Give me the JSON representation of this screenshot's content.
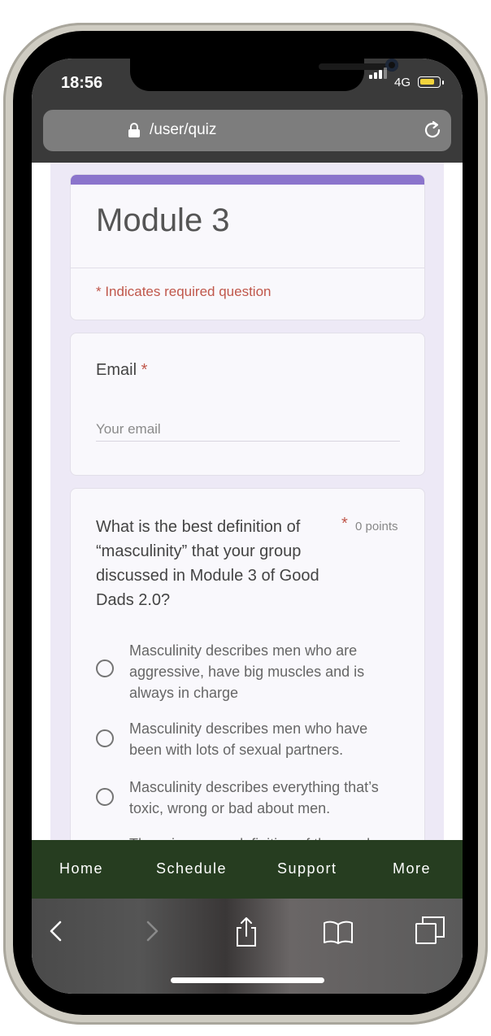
{
  "status_bar": {
    "time": "18:56",
    "network": "4G"
  },
  "browser": {
    "url": "/user/quiz"
  },
  "form": {
    "title": "Module 3",
    "required_note": "* Indicates required question",
    "email": {
      "label": "Email",
      "required_mark": "*",
      "placeholder": "Your email",
      "value": ""
    },
    "question": {
      "text": "What is the best definition of “masculinity” that your group discussed in Module 3 of Good Dads 2.0?",
      "required_mark": "*",
      "points": "0 points",
      "options": [
        "Masculinity describes men who are aggressive, have big muscles and is always in charge",
        "Masculinity describes men who have been with lots of sexual partners.",
        "Masculinity describes everything that’s toxic, wrong or bad about men.",
        "There is no one definition of the word..."
      ]
    }
  },
  "bottom_nav": {
    "items": [
      "Home",
      "Schedule",
      "Support",
      "More"
    ]
  },
  "colors": {
    "accent": "#8b74cc",
    "required": "#c0574b",
    "nav_bg": "#263d20",
    "form_bg": "#ede9f6"
  }
}
